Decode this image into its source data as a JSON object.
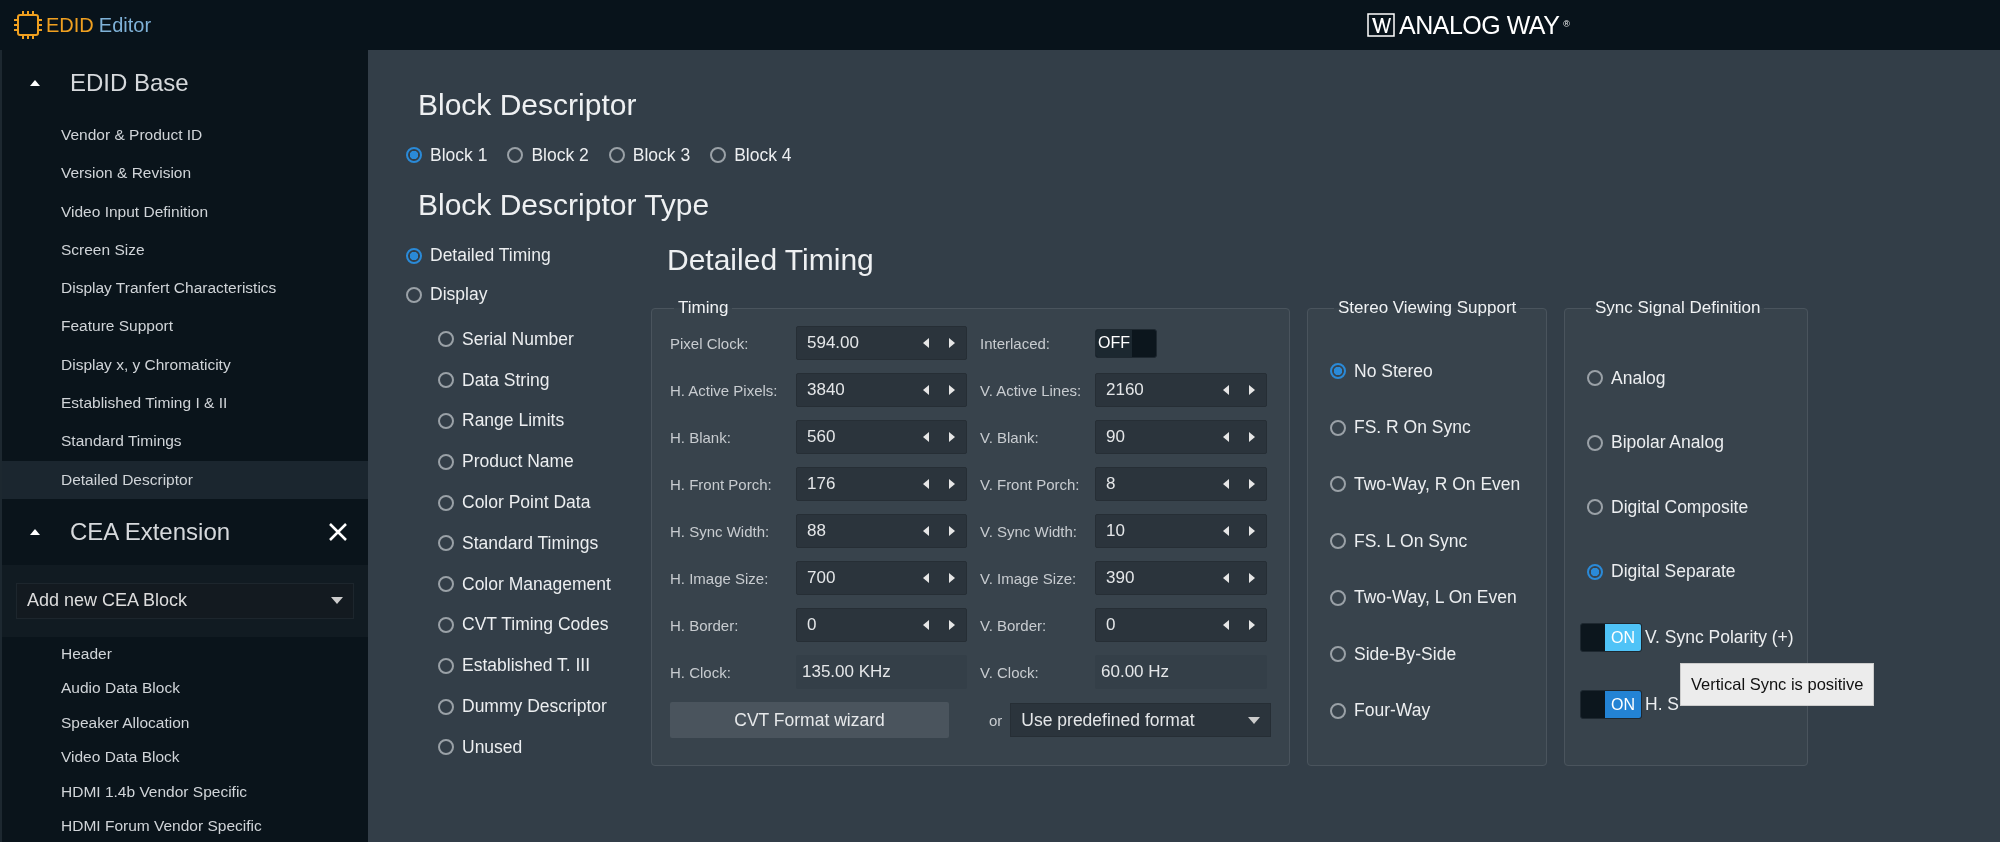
{
  "header": {
    "logo": {
      "part_1": "EDID",
      "part_2": "Editor"
    },
    "brand": {
      "name": "ANALOG WAY",
      "mark": "®"
    }
  },
  "sidebar": {
    "sections": [
      {
        "title": "EDID Base",
        "expanded": true,
        "removable": false,
        "items": [
          {
            "label": "Vendor & Product ID",
            "selected": false
          },
          {
            "label": "Version & Revision",
            "selected": false
          },
          {
            "label": "Video Input Definition",
            "selected": false
          },
          {
            "label": "Screen Size",
            "selected": false
          },
          {
            "label": "Display Tranfert Characteristics",
            "selected": false
          },
          {
            "label": "Feature Support",
            "selected": false
          },
          {
            "label": "Display x, y Chromaticity",
            "selected": false
          },
          {
            "label": "Established Timing I & II",
            "selected": false
          },
          {
            "label": "Standard Timings",
            "selected": false
          },
          {
            "label": "Detailed Descriptor",
            "selected": true
          }
        ]
      },
      {
        "title": "CEA Extension",
        "expanded": true,
        "removable": true,
        "add_select": {
          "value": "Add new CEA Block"
        },
        "items": [
          {
            "label": "Header",
            "selected": false
          },
          {
            "label": "Audio Data Block",
            "selected": false
          },
          {
            "label": "Speaker Allocation",
            "selected": false
          },
          {
            "label": "Video Data Block",
            "selected": false
          },
          {
            "label": "HDMI 1.4b Vendor Specific",
            "selected": false
          },
          {
            "label": "HDMI Forum Vendor Specific",
            "selected": false
          }
        ]
      }
    ]
  },
  "main": {
    "title": "Block Descriptor",
    "blocks": [
      {
        "label": "Block 1",
        "selected": true
      },
      {
        "label": "Block 2",
        "selected": false
      },
      {
        "label": "Block 3",
        "selected": false
      },
      {
        "label": "Block 4",
        "selected": false
      }
    ],
    "type_title": "Block Descriptor Type",
    "types": [
      {
        "label": "Detailed Timing",
        "selected": true
      },
      {
        "label": "Display",
        "selected": false,
        "children": [
          {
            "label": "Serial Number",
            "selected": false
          },
          {
            "label": "Data String",
            "selected": false
          },
          {
            "label": "Range Limits",
            "selected": false
          },
          {
            "label": "Product Name",
            "selected": false
          },
          {
            "label": "Color Point Data",
            "selected": false
          },
          {
            "label": "Standard Timings",
            "selected": false
          },
          {
            "label": "Color Management",
            "selected": false
          },
          {
            "label": "CVT Timing Codes",
            "selected": false
          },
          {
            "label": "Established T. III",
            "selected": false
          },
          {
            "label": "Dummy Descriptor",
            "selected": false
          },
          {
            "label": "Unused",
            "selected": false
          }
        ]
      }
    ],
    "detail_title": "Detailed Timing",
    "timing": {
      "legend": "Timing",
      "rows": [
        {
          "left": {
            "label": "Pixel Clock:",
            "kind": "spin",
            "value": "594.00"
          },
          "right": {
            "label": "Interlaced:",
            "kind": "toggle",
            "on": false,
            "text": "OFF"
          }
        },
        {
          "left": {
            "label": "H. Active Pixels:",
            "kind": "spin",
            "value": "3840"
          },
          "right": {
            "label": "V. Active Lines:",
            "kind": "spin",
            "value": "2160"
          }
        },
        {
          "left": {
            "label": "H. Blank:",
            "kind": "spin",
            "value": "560"
          },
          "right": {
            "label": "V. Blank:",
            "kind": "spin",
            "value": "90"
          }
        },
        {
          "left": {
            "label": "H. Front Porch:",
            "kind": "spin",
            "value": "176"
          },
          "right": {
            "label": "V. Front Porch:",
            "kind": "spin",
            "value": "8"
          }
        },
        {
          "left": {
            "label": "H. Sync Width:",
            "kind": "spin",
            "value": "88"
          },
          "right": {
            "label": "V. Sync Width:",
            "kind": "spin",
            "value": "10"
          }
        },
        {
          "left": {
            "label": "H. Image Size:",
            "kind": "spin",
            "value": "700"
          },
          "right": {
            "label": "V. Image Size:",
            "kind": "spin",
            "value": "390"
          }
        },
        {
          "left": {
            "label": "H. Border:",
            "kind": "spin",
            "value": "0"
          },
          "right": {
            "label": "V. Border:",
            "kind": "spin",
            "value": "0"
          }
        },
        {
          "left": {
            "label": "H. Clock:",
            "kind": "readout",
            "value": "135.00 KHz"
          },
          "right": {
            "label": "V. Clock:",
            "kind": "readout",
            "value": "60.00 Hz"
          }
        }
      ],
      "cvt_button": "CVT Format wizard",
      "or": "or",
      "format_select": {
        "value": "Use predefined format"
      }
    },
    "stereo": {
      "legend": "Stereo Viewing Support",
      "options": [
        {
          "label": "No Stereo",
          "selected": true
        },
        {
          "label": "FS. R On Sync",
          "selected": false
        },
        {
          "label": "Two-Way, R On Even",
          "selected": false
        },
        {
          "label": "FS. L On Sync",
          "selected": false
        },
        {
          "label": "Two-Way, L On Even",
          "selected": false
        },
        {
          "label": "Side-By-Side",
          "selected": false
        },
        {
          "label": "Four-Way",
          "selected": false
        }
      ]
    },
    "sync": {
      "legend": "Sync Signal Definition",
      "options": [
        {
          "label": "Analog",
          "selected": false
        },
        {
          "label": "Bipolar Analog",
          "selected": false
        },
        {
          "label": "Digital Composite",
          "selected": false
        },
        {
          "label": "Digital Separate",
          "selected": true
        }
      ],
      "toggles": [
        {
          "label": "V. Sync Polarity (+)",
          "on": true,
          "text": "ON",
          "hovered": true
        },
        {
          "label": "H. S",
          "on": true,
          "text": "ON",
          "hovered": false
        }
      ],
      "tooltip": {
        "text": "Vertical Sync is positive"
      }
    }
  }
}
